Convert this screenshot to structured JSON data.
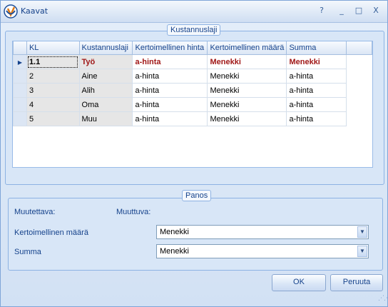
{
  "window": {
    "title": "Kaavat",
    "buttons": {
      "help": "?",
      "minimize": "_",
      "maximize": "□",
      "close": "X"
    }
  },
  "kustannuslaji_group": {
    "title": "Kustannuslaji",
    "columns": [
      "KL",
      "Kustannuslaji",
      "Kertoimellinen hinta",
      "Kertoimellinen määrä",
      "Summa"
    ],
    "rows": [
      [
        "1.1",
        "Työ",
        "a-hinta",
        "Menekki",
        "Menekki"
      ],
      [
        "2",
        "Aine",
        "a-hinta",
        "Menekki",
        "a-hinta"
      ],
      [
        "3",
        "Alih",
        "a-hinta",
        "Menekki",
        "a-hinta"
      ],
      [
        "4",
        "Oma",
        "a-hinta",
        "Menekki",
        "a-hinta"
      ],
      [
        "5",
        "Muu",
        "a-hinta",
        "Menekki",
        "a-hinta"
      ]
    ],
    "current_row_indicator": "▶"
  },
  "panos_group": {
    "title": "Panos",
    "muutettava_label": "Muutettava:",
    "muuttuva_label": "Muuttuva:",
    "kertoimellinen_maara_label": "Kertoimellinen määrä",
    "kertoimellinen_maara_value": "Menekki",
    "summa_label": "Summa",
    "summa_value": "Menekki"
  },
  "buttons": {
    "ok": "OK",
    "cancel": "Peruuta"
  }
}
